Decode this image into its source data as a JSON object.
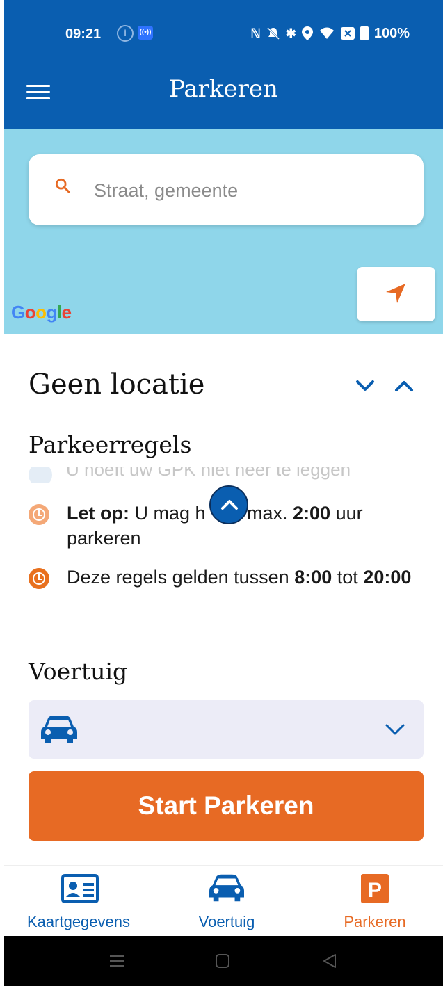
{
  "status_bar": {
    "time": "09:21",
    "battery": "100%",
    "icons": [
      "info-icon",
      "radio-icon",
      "nfc-icon",
      "mute-icon",
      "bluetooth-icon",
      "location-icon",
      "wifi-icon",
      "sim-icon",
      "battery-icon"
    ]
  },
  "header": {
    "title": "Parkeren",
    "menu_icon": "hamburger-menu-icon",
    "background": "#0a5eb0"
  },
  "map": {
    "search_placeholder": "Straat, gemeente",
    "search_icon": "search-icon",
    "locate_icon": "navigation-arrow-icon",
    "attribution": "Google",
    "background": "#8fd6ea"
  },
  "location": {
    "title": "Geen locatie"
  },
  "rules": {
    "title": "Parkeerregels",
    "faded_text": "U hoeft uw GPK niet neer te leggen",
    "items": [
      {
        "label": "Let op:",
        "text_a": " U mag h",
        "text_b": " max. ",
        "value": "2:00",
        "text_c": " uur parkeren"
      },
      {
        "text_a": "Deze regels gelden tussen ",
        "from": "8:00",
        "text_b": " tot ",
        "to": "20:00"
      }
    ]
  },
  "vehicle": {
    "title": "Voertuig",
    "selected": ""
  },
  "actions": {
    "start_label": "Start Parkeren",
    "accent": "#e76a24"
  },
  "bottom_nav": {
    "items": [
      {
        "label": "Kaartgegevens",
        "icon": "id-card-icon"
      },
      {
        "label": "Voertuig",
        "icon": "car-icon"
      },
      {
        "label": "Parkeren",
        "icon": "parking-icon",
        "active": true
      }
    ]
  }
}
